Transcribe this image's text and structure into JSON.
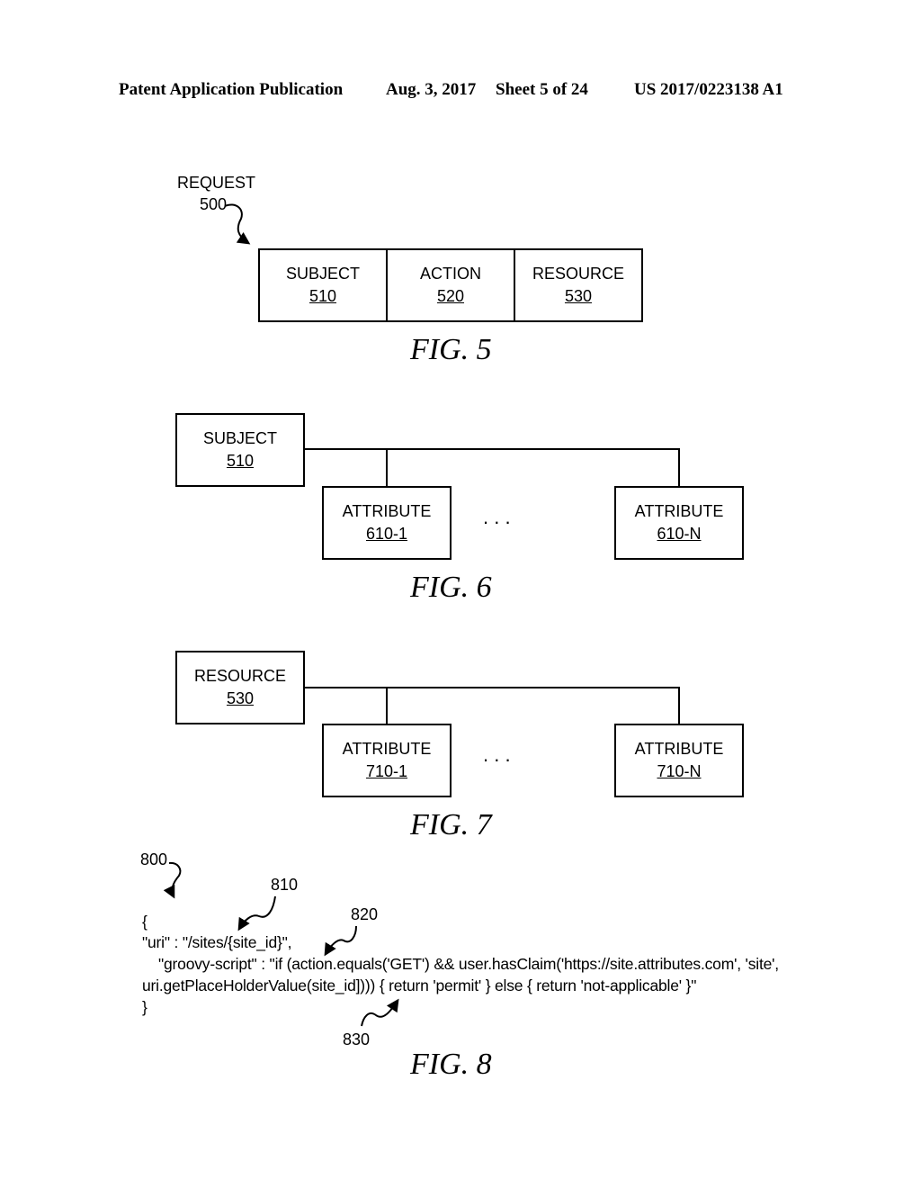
{
  "header": {
    "publication": "Patent Application Publication",
    "date": "Aug. 3, 2017",
    "sheet": "Sheet 5 of 24",
    "number": "US 2017/0223138 A1"
  },
  "fig5": {
    "ref_label": "REQUEST",
    "ref_number": "500",
    "boxes": [
      {
        "label": "SUBJECT",
        "number": "510"
      },
      {
        "label": "ACTION",
        "number": "520"
      },
      {
        "label": "RESOURCE",
        "number": "530"
      }
    ],
    "caption": "FIG. 5"
  },
  "fig6": {
    "parent": {
      "label": "SUBJECT",
      "number": "510"
    },
    "children": [
      {
        "label": "ATTRIBUTE",
        "number": "610-1"
      },
      {
        "label": "ATTRIBUTE",
        "number": "610-N"
      }
    ],
    "ellipsis": ".     .     .",
    "caption": "FIG. 6"
  },
  "fig7": {
    "parent": {
      "label": "RESOURCE",
      "number": "530"
    },
    "children": [
      {
        "label": "ATTRIBUTE",
        "number": "710-1"
      },
      {
        "label": "ATTRIBUTE",
        "number": "710-N"
      }
    ],
    "ellipsis": ".     .     .",
    "caption": "FIG. 7"
  },
  "fig8": {
    "refs": {
      "r800": "800",
      "r810": "810",
      "r820": "820",
      "r830": "830"
    },
    "code_lines": [
      "{",
      "\"uri\" : \"/sites/{site_id}\",",
      "   \"groovy-script\" : \"if (action.equals('GET') && user.hasClaim('https://site.attributes.com', 'site',",
      "uri.getPlaceHolderValue(site_id]))) { return 'permit' } else { return 'not-applicable' }\"",
      "}"
    ],
    "caption": "FIG. 8"
  }
}
